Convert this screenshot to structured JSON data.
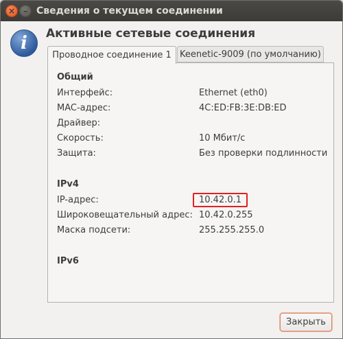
{
  "window": {
    "title": "Сведения о текущем соединении",
    "close_glyph": "×",
    "minimize_glyph": "–"
  },
  "header": {
    "icon_glyph": "i",
    "heading": "Активные сетевые соединения"
  },
  "tabs": [
    {
      "label": "Проводное соединение 1",
      "active": true
    },
    {
      "label": "Keenetic-9009 (по умолчанию)",
      "active": false
    }
  ],
  "general": {
    "title": "Общий",
    "rows": [
      {
        "label": "Интерфейс:",
        "value": "Ethernet (eth0)"
      },
      {
        "label": "MAC-адрес:",
        "value": "4C:ED:FB:3E:DB:ED"
      },
      {
        "label": "Драйвер:",
        "value": ""
      },
      {
        "label": "Скорость:",
        "value": "10 Мбит/с"
      },
      {
        "label": "Защита:",
        "value": "Без проверки подлинности"
      }
    ]
  },
  "ipv4": {
    "title": "IPv4",
    "rows": [
      {
        "label": "IP-адрес:",
        "value": "10.42.0.1"
      },
      {
        "label": "Широковещательный адрес:",
        "value": "10.42.0.255"
      },
      {
        "label": "Маска подсети:",
        "value": "255.255.255.0"
      }
    ]
  },
  "ipv6": {
    "title": "IPv6"
  },
  "footer": {
    "close_label": "Закрыть"
  },
  "colors": {
    "titlebar": "#3c3b37",
    "close_button": "#e0521a",
    "highlight_box": "#e02020",
    "info_icon": "#2f5b9c"
  }
}
